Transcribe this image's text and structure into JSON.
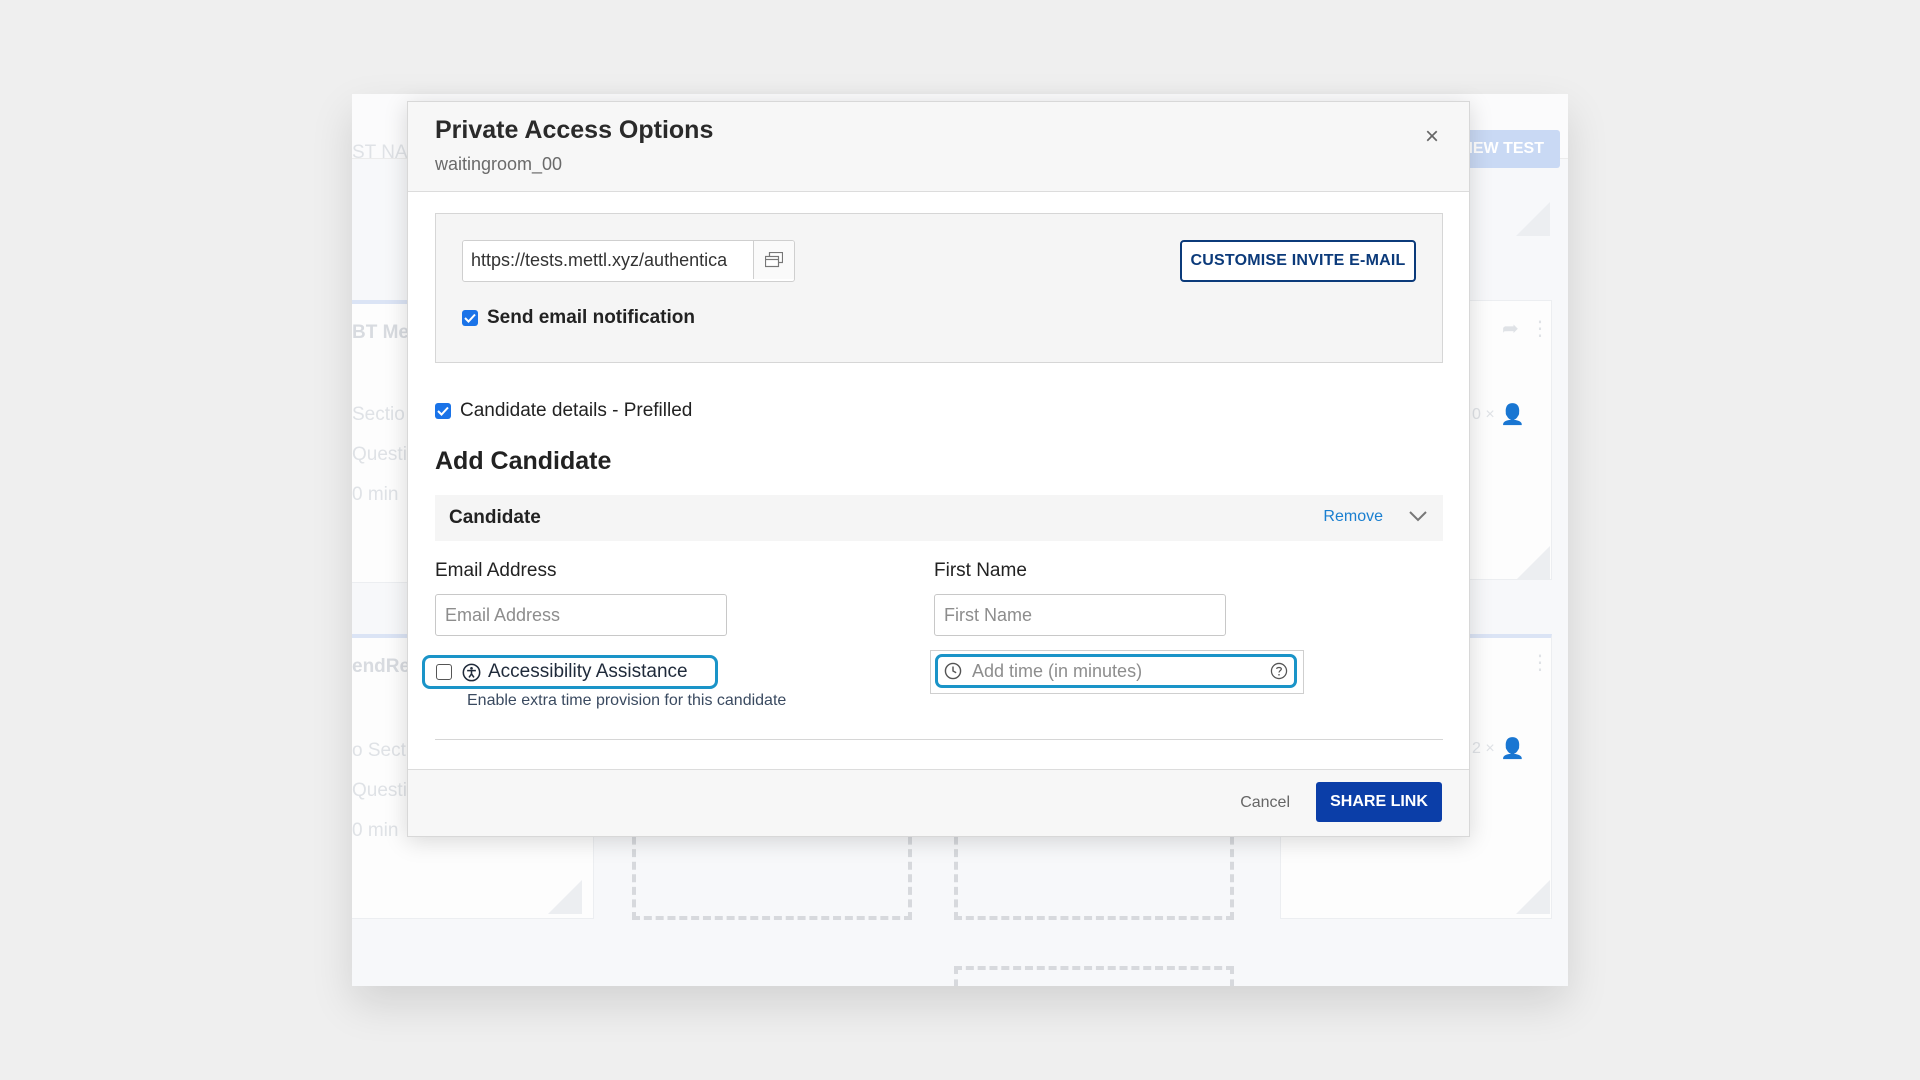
{
  "background": {
    "header_fragment": "ST NAM",
    "new_test_fragment": "NEW TEST",
    "card1_title_fragment": "BT Me",
    "card2_title_fragment": "endRe",
    "card1_lines": [
      "Sectio",
      "Questi",
      "0 min"
    ],
    "card2_lines": [
      "o Secti",
      "Questi",
      "0 min"
    ],
    "card1_count": "0 ×",
    "card2_count": "2 ×"
  },
  "modal": {
    "title": "Private Access Options",
    "subtitle": "waitingroom_00",
    "close_glyph": "×",
    "link": {
      "value": "https://tests.mettl.xyz/authentica",
      "copy_icon": "copy-icon"
    },
    "customise_label": "CUSTOMISE INVITE E-MAIL",
    "send_email_label": "Send email notification",
    "send_email_checked": true,
    "prefilled_label": "Candidate details - Prefilled",
    "prefilled_checked": true,
    "section_title": "Add Candidate",
    "candidate": {
      "title": "Candidate",
      "remove_label": "Remove",
      "email_label": "Email Address",
      "email_placeholder": "Email Address",
      "first_name_label": "First Name",
      "first_name_placeholder": "First Name",
      "accessibility_label": "Accessibility Assistance",
      "accessibility_checked": false,
      "accessibility_help": "Enable extra time provision for this candidate",
      "time_placeholder": "Add time (in minutes)"
    },
    "cancel_label": "Cancel",
    "share_label": "SHARE LINK"
  },
  "colors": {
    "primary": "#0b3ea8",
    "focus_ring": "#1a94c8",
    "link": "#1a7fd0",
    "checkbox": "#1a73e8"
  }
}
